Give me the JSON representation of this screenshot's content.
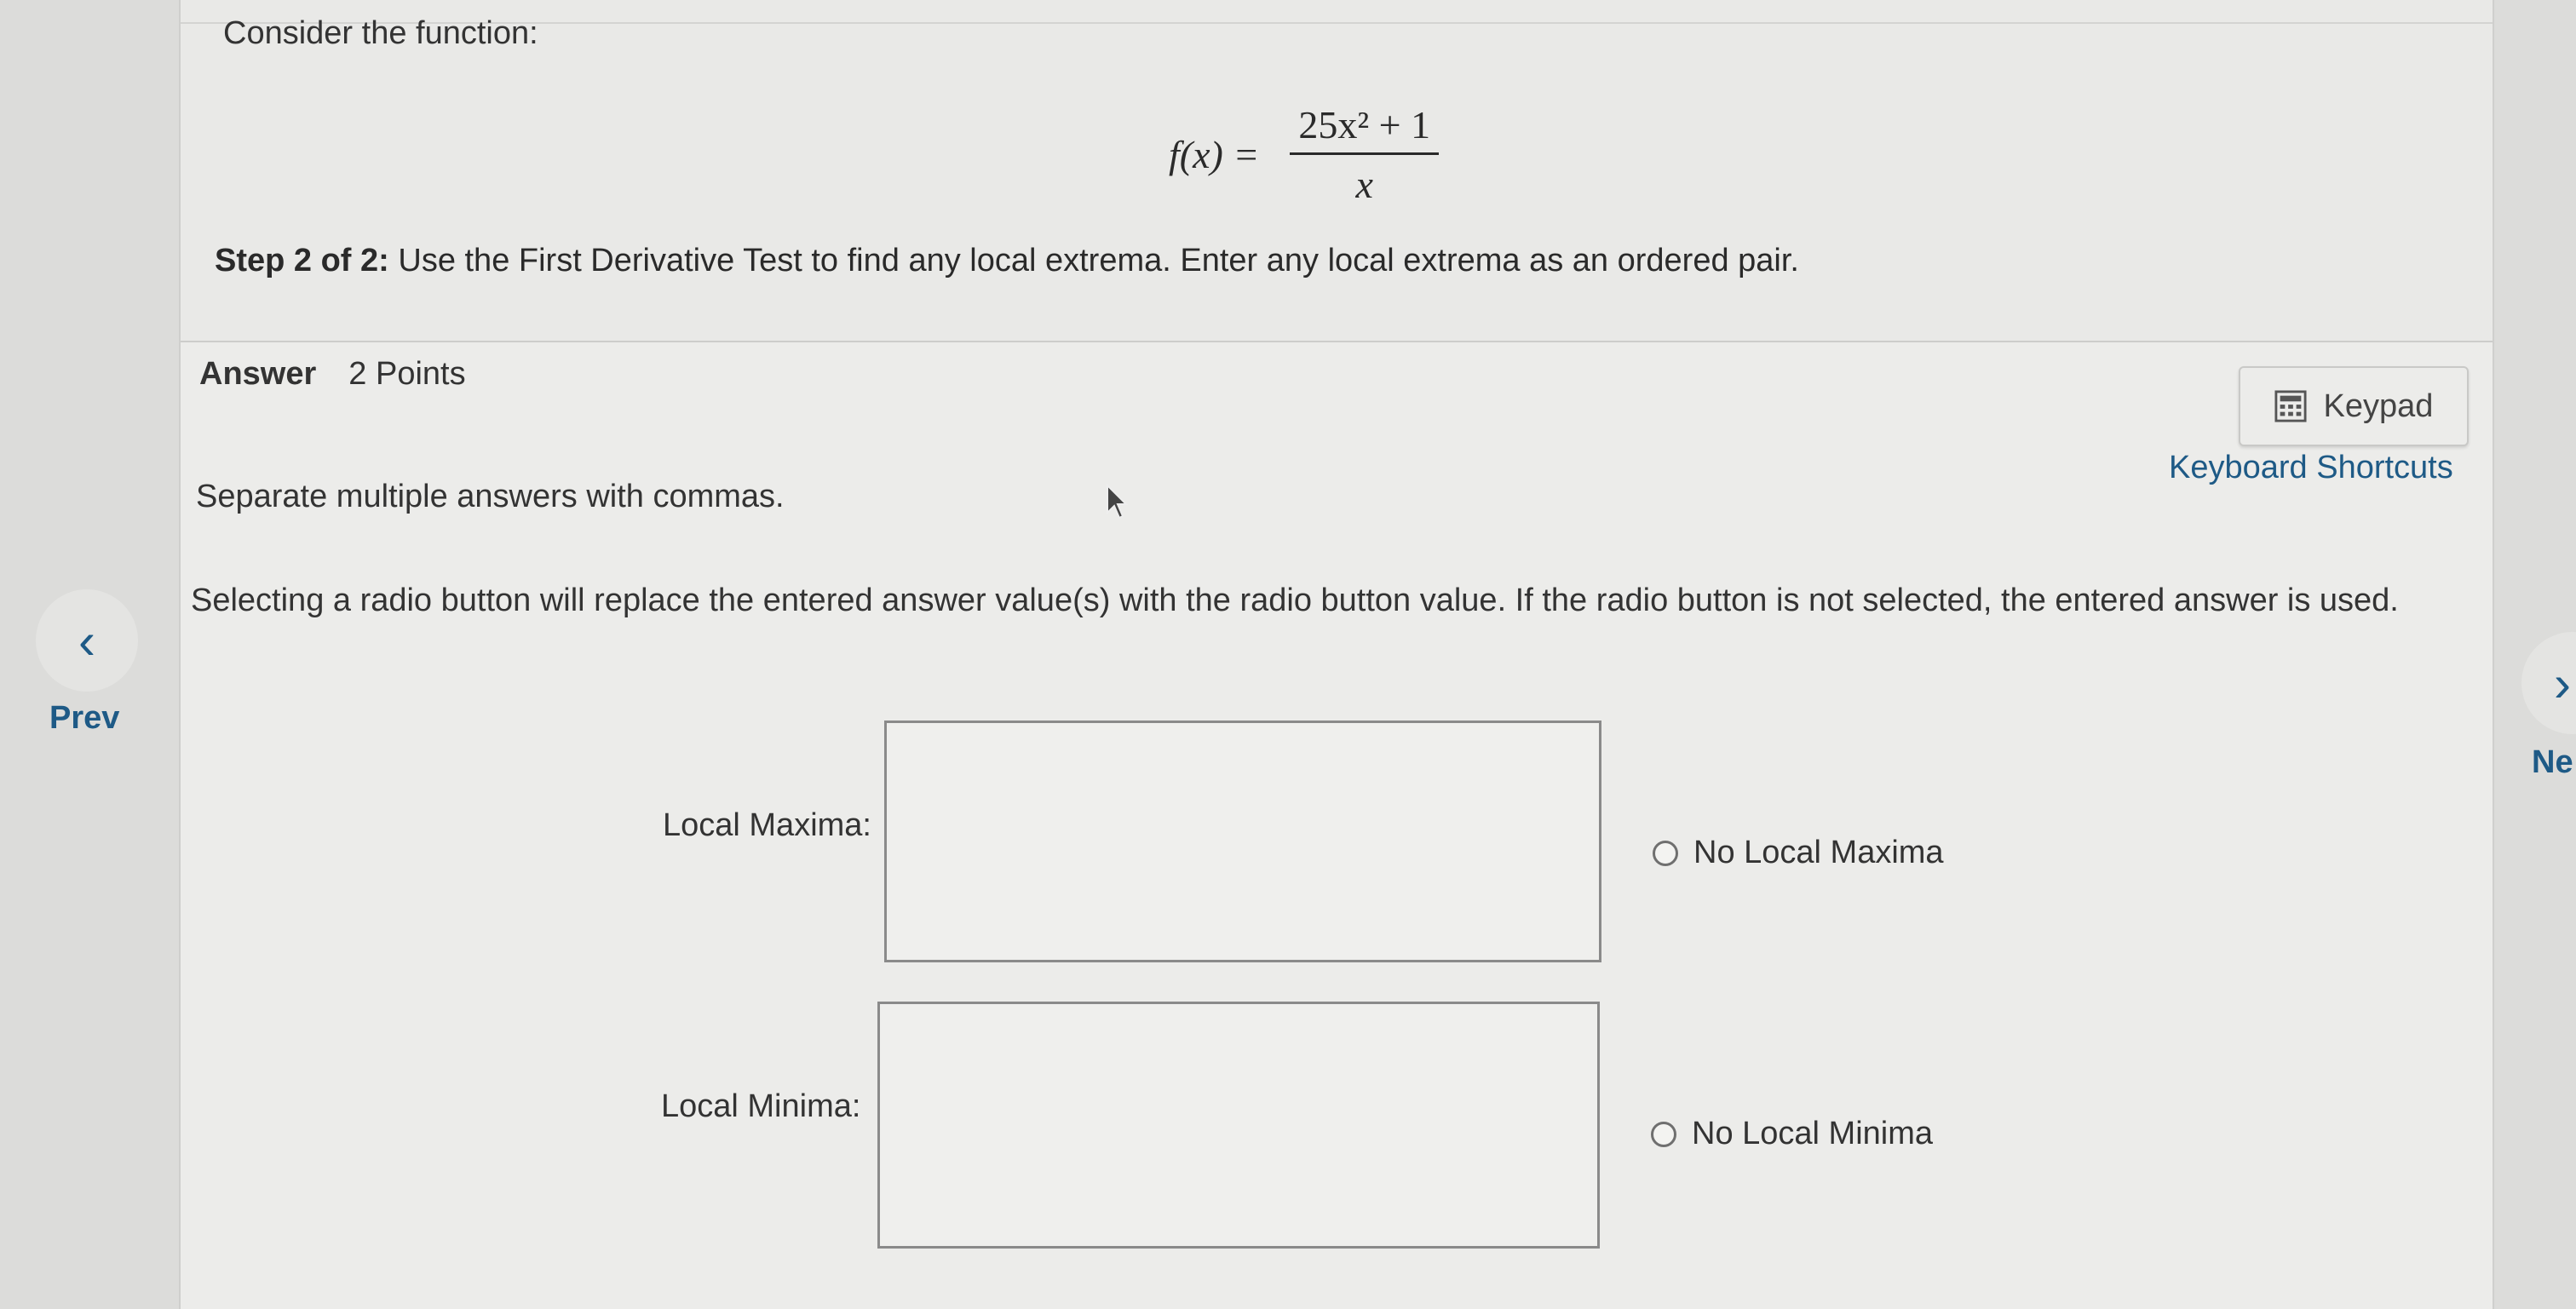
{
  "question": {
    "intro": "Consider the function:",
    "formula": {
      "lhs": "f(x) =",
      "numerator": "25x² + 1",
      "denominator": "x"
    },
    "step_label": "Step 2 of 2:",
    "step_text": " Use the First Derivative Test to find any local extrema. Enter any local extrema as an ordered pair."
  },
  "answer": {
    "heading": "Answer",
    "points": "2 Points",
    "keypad_label": "Keypad",
    "keypad_icon": "calculator-icon",
    "shortcuts_label": "Keyboard Shortcuts",
    "instruction": "Separate multiple answers with commas.",
    "replace_note": "Selecting a radio button will replace the entered answer value(s) with the radio button value. If the radio button is not selected, the entered answer is used.",
    "maxima": {
      "label": "Local Maxima:",
      "value": "",
      "radio_label": "No Local Maxima"
    },
    "minima": {
      "label": "Local Minima:",
      "value": "",
      "radio_label": "No Local Minima"
    }
  },
  "nav": {
    "prev_label": "Prev",
    "prev_icon": "chevron-left-icon",
    "next_label": "Ne",
    "next_icon": "chevron-right-icon"
  },
  "colors": {
    "link": "#1e5a86",
    "panel": "#ececea",
    "border": "#8a8a8a"
  }
}
